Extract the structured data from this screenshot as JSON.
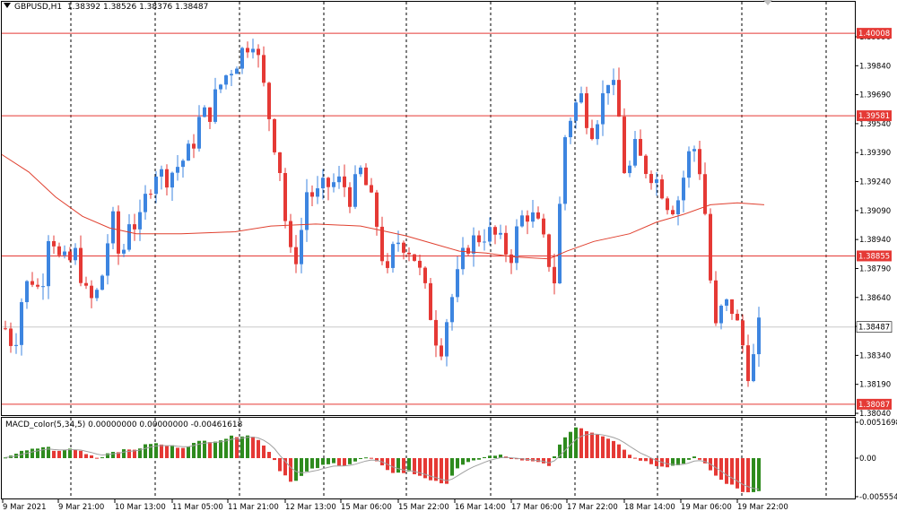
{
  "symbol_header": {
    "symbol": "GBPUSD,H1",
    "ohlc": "1.38392 1.38526 1.38376 1.38487"
  },
  "price_axis": {
    "ticks": [
      "1.39990",
      "1.39840",
      "1.39690",
      "1.39540",
      "1.39390",
      "1.39240",
      "1.39090",
      "1.38940",
      "1.38790",
      "1.38640",
      "1.38490",
      "1.38340",
      "1.38190",
      "1.38040"
    ],
    "level_labels": [
      {
        "value": "1.40008",
        "color": "#e53935"
      },
      {
        "value": "1.39581",
        "color": "#e53935"
      },
      {
        "value": "1.38855",
        "color": "#e53935"
      },
      {
        "value": "1.38087",
        "color": "#e53935"
      }
    ],
    "current_price": "1.38487"
  },
  "macd": {
    "label": "MACD_color(5,34,5) 0.00000000 0.00000000 -0.00461618",
    "axis_ticks": [
      "0.0051698",
      "0.00",
      "-0.005554"
    ]
  },
  "time_axis": {
    "labels": [
      "9 Mar 2021",
      "9 Mar 21:00",
      "10 Mar 13:00",
      "11 Mar 05:00",
      "11 Mar 21:00",
      "12 Mar 13:00",
      "15 Mar 06:00",
      "15 Mar 22:00",
      "16 Mar 14:00",
      "17 Mar 06:00",
      "17 Mar 22:00",
      "18 Mar 14:00",
      "19 Mar 06:00",
      "19 Mar 22:00"
    ]
  },
  "colors": {
    "bull": "#3d85e0",
    "bear": "#e53935",
    "ma_line": "#e0402f",
    "level_line": "#e53935",
    "macd_up": "#2e8b1e",
    "macd_down": "#e53935",
    "macd_signal": "#a0a0a0",
    "grid": "#000000"
  },
  "chart_data": {
    "type": "candlestick",
    "symbol": "GBPUSD",
    "timeframe": "H1",
    "ylim": [
      1.3804,
      1.4004
    ],
    "horizontal_levels": [
      1.40008,
      1.39581,
      1.38855,
      1.38087
    ],
    "current_price": 1.38487,
    "close_path": [
      [
        0,
        1.3848
      ],
      [
        10,
        1.3838
      ],
      [
        20,
        1.3868
      ],
      [
        30,
        1.3874
      ],
      [
        40,
        1.3866
      ],
      [
        50,
        1.3903
      ],
      [
        60,
        1.3884
      ],
      [
        70,
        1.3881
      ],
      [
        80,
        1.3887
      ],
      [
        90,
        1.3866
      ],
      [
        100,
        1.3861
      ],
      [
        110,
        1.3877
      ],
      [
        120,
        1.3907
      ],
      [
        130,
        1.388
      ],
      [
        140,
        1.3906
      ],
      [
        150,
        1.3899
      ],
      [
        160,
        1.3919
      ],
      [
        170,
        1.393
      ],
      [
        180,
        1.3926
      ],
      [
        190,
        1.393
      ],
      [
        200,
        1.3935
      ],
      [
        210,
        1.3941
      ],
      [
        220,
        1.3958
      ],
      [
        230,
        1.3959
      ],
      [
        240,
        1.3972
      ],
      [
        250,
        1.398
      ],
      [
        260,
        1.3986
      ],
      [
        270,
        1.3994
      ],
      [
        280,
        1.3999
      ],
      [
        290,
        1.3976
      ],
      [
        300,
        1.3952
      ],
      [
        310,
        1.393
      ],
      [
        320,
        1.3885
      ],
      [
        330,
        1.3886
      ],
      [
        340,
        1.3919
      ],
      [
        350,
        1.3916
      ],
      [
        360,
        1.3921
      ],
      [
        370,
        1.3923
      ],
      [
        380,
        1.3924
      ],
      [
        390,
        1.3915
      ],
      [
        400,
        1.393
      ],
      [
        410,
        1.3918
      ],
      [
        420,
        1.39
      ],
      [
        430,
        1.3872
      ],
      [
        440,
        1.3894
      ],
      [
        450,
        1.3892
      ],
      [
        460,
        1.3887
      ],
      [
        470,
        1.3873
      ],
      [
        480,
        1.3855
      ],
      [
        490,
        1.3835
      ],
      [
        500,
        1.3858
      ],
      [
        510,
        1.3874
      ],
      [
        520,
        1.3891
      ],
      [
        530,
        1.3894
      ],
      [
        540,
        1.3897
      ],
      [
        550,
        1.3897
      ],
      [
        560,
        1.3891
      ],
      [
        570,
        1.3885
      ],
      [
        580,
        1.3904
      ],
      [
        590,
        1.3908
      ],
      [
        600,
        1.3902
      ],
      [
        610,
        1.3888
      ],
      [
        620,
        1.3872
      ],
      [
        630,
        1.3945
      ],
      [
        640,
        1.3962
      ],
      [
        650,
        1.3968
      ],
      [
        660,
        1.395
      ],
      [
        670,
        1.3961
      ],
      [
        680,
        1.3978
      ],
      [
        690,
        1.3966
      ],
      [
        700,
        1.3923
      ],
      [
        710,
        1.3941
      ],
      [
        720,
        1.3932
      ],
      [
        730,
        1.3928
      ],
      [
        740,
        1.3921
      ],
      [
        750,
        1.391
      ],
      [
        760,
        1.3916
      ],
      [
        770,
        1.3937
      ],
      [
        780,
        1.3943
      ],
      [
        790,
        1.3905
      ],
      [
        800,
        1.3845
      ],
      [
        810,
        1.3861
      ],
      [
        820,
        1.3858
      ],
      [
        830,
        1.3843
      ],
      [
        840,
        1.3822
      ],
      [
        850,
        1.3848
      ]
    ],
    "moving_average": [
      [
        0,
        1.3938
      ],
      [
        30,
        1.3929
      ],
      [
        60,
        1.3916
      ],
      [
        90,
        1.3906
      ],
      [
        120,
        1.39
      ],
      [
        150,
        1.3897
      ],
      [
        200,
        1.3897
      ],
      [
        260,
        1.3898
      ],
      [
        300,
        1.3901
      ],
      [
        350,
        1.3902
      ],
      [
        400,
        1.3901
      ],
      [
        450,
        1.3896
      ],
      [
        480,
        1.3892
      ],
      [
        510,
        1.3888
      ],
      [
        540,
        1.3887
      ],
      [
        570,
        1.3885
      ],
      [
        610,
        1.3884
      ],
      [
        630,
        1.3888
      ],
      [
        660,
        1.3893
      ],
      [
        700,
        1.3897
      ],
      [
        730,
        1.3903
      ],
      [
        760,
        1.3907
      ],
      [
        790,
        1.3912
      ],
      [
        820,
        1.3913
      ],
      [
        850,
        1.3912
      ]
    ],
    "macd_histogram_path": [
      [
        0,
        0.0002
      ],
      [
        15,
        0.0008
      ],
      [
        30,
        0.0012
      ],
      [
        45,
        0.0017
      ],
      [
        60,
        0.0009
      ],
      [
        75,
        0.0014
      ],
      [
        90,
        0.0008
      ],
      [
        105,
        0.0
      ],
      [
        120,
        0.001
      ],
      [
        135,
        0.0011
      ],
      [
        150,
        0.0014
      ],
      [
        165,
        0.0022
      ],
      [
        180,
        0.0018
      ],
      [
        200,
        0.0016
      ],
      [
        220,
        0.0024
      ],
      [
        240,
        0.0026
      ],
      [
        260,
        0.0032
      ],
      [
        275,
        0.0034
      ],
      [
        290,
        0.0022
      ],
      [
        300,
        0.0006
      ],
      [
        310,
        -0.0018
      ],
      [
        325,
        -0.0036
      ],
      [
        340,
        -0.002
      ],
      [
        355,
        -0.0012
      ],
      [
        370,
        -0.0008
      ],
      [
        385,
        -0.001
      ],
      [
        400,
        -0.0002
      ],
      [
        410,
        0.0002
      ],
      [
        425,
        -0.0012
      ],
      [
        440,
        -0.0022
      ],
      [
        455,
        -0.002
      ],
      [
        470,
        -0.0026
      ],
      [
        485,
        -0.0034
      ],
      [
        495,
        -0.004
      ],
      [
        510,
        -0.0014
      ],
      [
        525,
        -0.0006
      ],
      [
        540,
        0.0002
      ],
      [
        560,
        0.0004
      ],
      [
        580,
        -0.0004
      ],
      [
        600,
        -0.0006
      ],
      [
        615,
        -0.001
      ],
      [
        630,
        0.003
      ],
      [
        645,
        0.0046
      ],
      [
        660,
        0.0038
      ],
      [
        675,
        0.0032
      ],
      [
        690,
        0.0024
      ],
      [
        705,
        0.0004
      ],
      [
        720,
        -0.0004
      ],
      [
        735,
        -0.001
      ],
      [
        750,
        -0.0012
      ],
      [
        765,
        -0.0008
      ],
      [
        775,
        0.0004
      ],
      [
        790,
        -0.001
      ],
      [
        805,
        -0.003
      ],
      [
        820,
        -0.004
      ],
      [
        835,
        -0.005
      ],
      [
        848,
        -0.0046
      ]
    ],
    "xlabel": "",
    "ylabel": ""
  }
}
